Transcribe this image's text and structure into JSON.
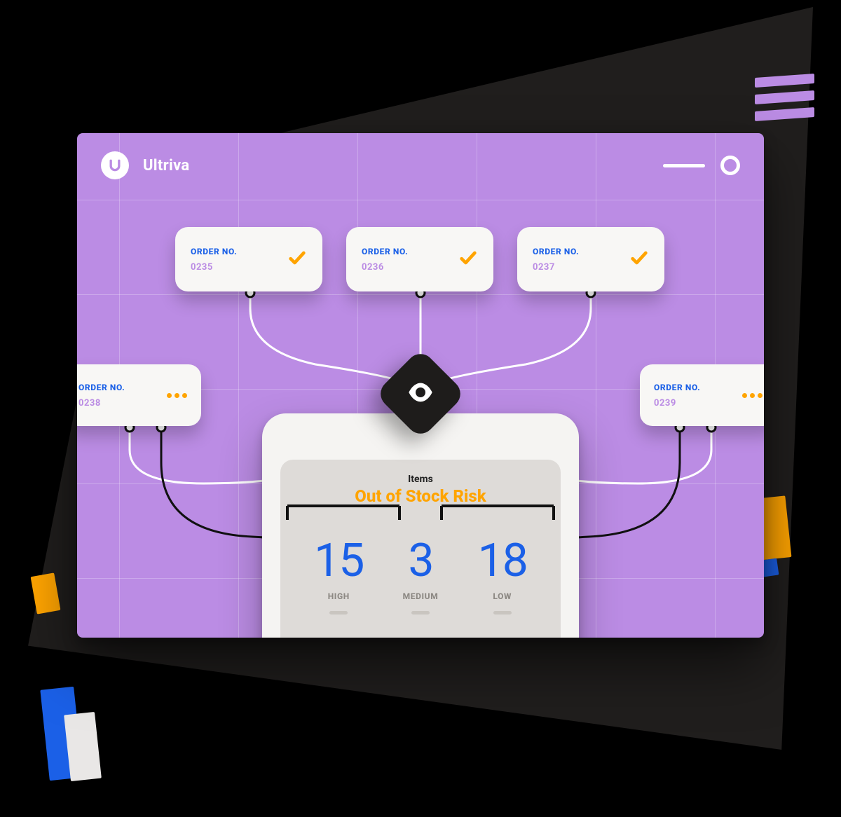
{
  "app": {
    "brand": "Ultriva",
    "logo_letter": "U"
  },
  "colors": {
    "accent": "#ffa400",
    "primary": "#1b60e7",
    "purple": "#bb8ce4"
  },
  "orders": {
    "label": "ORDER NO.",
    "top": [
      {
        "id": "0235",
        "status": "check"
      },
      {
        "id": "0236",
        "status": "check"
      },
      {
        "id": "0237",
        "status": "check"
      }
    ],
    "side": [
      {
        "id": "0238",
        "status": "pending"
      },
      {
        "id": "0239",
        "status": "pending"
      }
    ]
  },
  "panel": {
    "items_label": "Items",
    "risk_label": "Out of Stock Risk",
    "metrics": [
      {
        "value": "15",
        "category": "HIGH"
      },
      {
        "value": "3",
        "category": "MEDIUM"
      },
      {
        "value": "18",
        "category": "LOW"
      }
    ]
  }
}
